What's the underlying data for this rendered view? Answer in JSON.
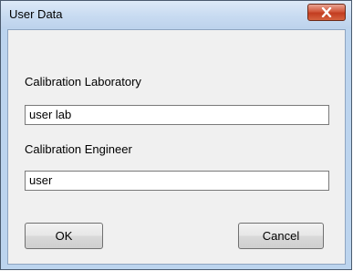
{
  "window": {
    "title": "User Data"
  },
  "form": {
    "lab_label": "Calibration Laboratory",
    "lab_value": "user lab",
    "engineer_label": "Calibration Engineer",
    "engineer_value": "user"
  },
  "buttons": {
    "ok": "OK",
    "cancel": "Cancel"
  },
  "icons": {
    "close": "close-icon"
  },
  "colors": {
    "close_button": "#c9462a",
    "titlebar": "#c8dbf1"
  }
}
